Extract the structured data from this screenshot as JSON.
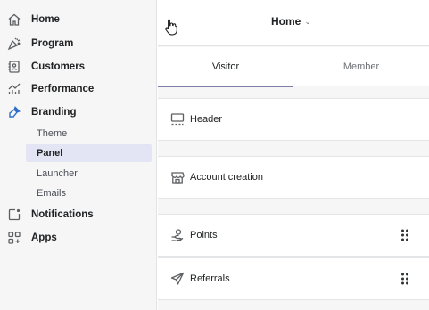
{
  "sidebar": {
    "items": [
      {
        "label": "Home",
        "icon": "home-icon"
      },
      {
        "label": "Program",
        "icon": "program-icon"
      },
      {
        "label": "Customers",
        "icon": "customers-icon"
      },
      {
        "label": "Performance",
        "icon": "performance-icon"
      },
      {
        "label": "Branding",
        "icon": "branding-icon",
        "selected": true
      },
      {
        "label": "Notifications",
        "icon": "notifications-icon"
      },
      {
        "label": "Apps",
        "icon": "apps-icon"
      }
    ],
    "branding_subitems": [
      {
        "label": "Theme"
      },
      {
        "label": "Panel",
        "active": true
      },
      {
        "label": "Launcher"
      },
      {
        "label": "Emails"
      }
    ]
  },
  "header": {
    "page_select": "Home",
    "chevron": "⌄"
  },
  "tabs": [
    {
      "label": "Visitor",
      "active": true
    },
    {
      "label": "Member"
    }
  ],
  "sections": [
    {
      "label": "Header",
      "icon": "header-layout-icon",
      "draggable": false
    },
    {
      "label": "Account creation",
      "icon": "store-icon",
      "draggable": false
    },
    {
      "label": "Points",
      "icon": "points-icon",
      "draggable": true
    },
    {
      "label": "Referrals",
      "icon": "referrals-icon",
      "draggable": true
    }
  ],
  "colors": {
    "accent": "#7c7fa6",
    "active_subitem_bg": "#e3e5f4",
    "branding_icon": "#2c6ecb"
  }
}
